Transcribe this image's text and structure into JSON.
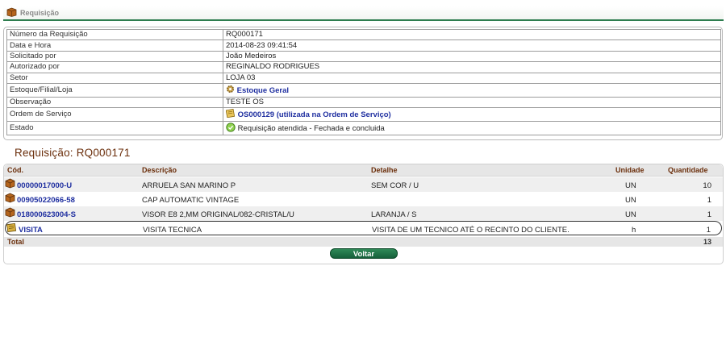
{
  "header": {
    "title": "Requisição"
  },
  "info": [
    {
      "label": "Número da Requisição",
      "value": "RQ000171"
    },
    {
      "label": "Data e Hora",
      "value": "2014-08-23 09:41:54"
    },
    {
      "label": "Solicitado por",
      "value": "João Medeiros"
    },
    {
      "label": "Autorizado por",
      "value": "REGINALDO RODRIGUES"
    },
    {
      "label": "Setor",
      "value": "LOJA 03"
    },
    {
      "label": "Estoque/Filial/Loja",
      "value": "Estoque Geral",
      "icon": "gear-icon"
    },
    {
      "label": "Observação",
      "value": "TESTE OS"
    },
    {
      "label": "Ordem de Serviço",
      "value": "OS000129 (utilizada na Ordem de Serviço)",
      "icon": "document-icon"
    },
    {
      "label": "Estado",
      "value": "Requisição atendida - Fechada e concluida",
      "icon": "status-ok-icon"
    }
  ],
  "title": "Requisição: RQ000171",
  "table": {
    "columns": {
      "code": "Cód.",
      "description": "Descrição",
      "detail": "Detalhe",
      "unit": "Unidade",
      "quantity": "Quantidade"
    },
    "rows": [
      {
        "code": "00000017000-U",
        "description": "ARRUELA SAN MARINO P",
        "detail": "SEM COR / U",
        "unit": "UN",
        "quantity": "10",
        "icon": "product-box-icon"
      },
      {
        "code": "00905022066-58",
        "description": "CAP AUTOMATIC VINTAGE",
        "detail": "",
        "unit": "UN",
        "quantity": "1",
        "icon": "product-box-icon"
      },
      {
        "code": "018000623004-S",
        "description": "VISOR E8 2,MM ORIGINAL/082-CRISTAL/U",
        "detail": "LARANJA / S",
        "unit": "UN",
        "quantity": "1",
        "icon": "product-box-icon"
      },
      {
        "code": "VISITA",
        "description": "VISITA TECNICA",
        "detail": "VISITA DE UM TECNICO ATÉ O RECINTO DO CLIENTE.",
        "unit": "h",
        "quantity": "1",
        "icon": "service-icon"
      }
    ],
    "total_label": "Total",
    "total_value": "13"
  },
  "buttons": {
    "back": "Voltar"
  },
  "colors": {
    "accent_green": "#2e7d4f",
    "title_brown": "#6b2f0c",
    "link_blue": "#1f2fa0"
  }
}
